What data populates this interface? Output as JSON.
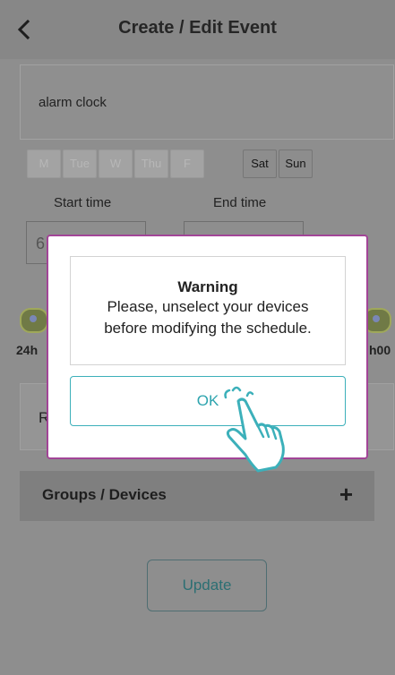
{
  "header": {
    "title": "Create / Edit Event"
  },
  "event": {
    "name": "alarm clock"
  },
  "days": {
    "weekdays": [
      "M",
      "Tue",
      "W",
      "Thu",
      "F"
    ],
    "weekend": [
      "Sat",
      "Sun"
    ]
  },
  "times": {
    "start_label": "Start time",
    "end_label": "End time",
    "start_value_partial": "6",
    "slider_left_label": "24h",
    "slider_right_label": "h00"
  },
  "row_partial_label": "R",
  "groups": {
    "label": "Groups / Devices",
    "add_symbol": "+"
  },
  "update_label": "Update",
  "dialog": {
    "title": "Warning",
    "line1": "Please, unselect your devices",
    "line2": "before modifying the schedule.",
    "ok_label": "OK"
  },
  "colors": {
    "accent": "#2da4ae",
    "dialog_border": "#a24597"
  }
}
